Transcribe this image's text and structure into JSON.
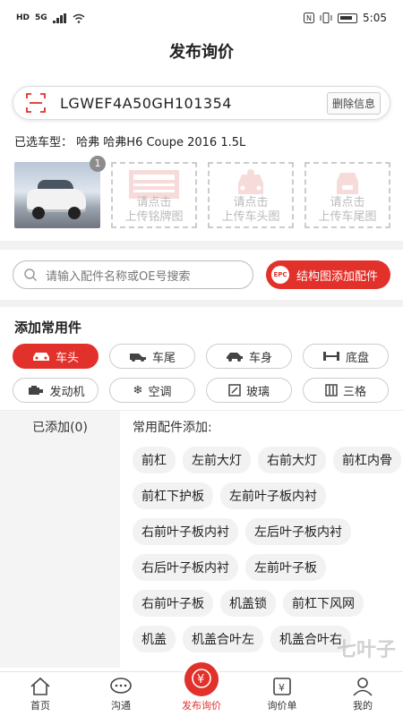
{
  "status": {
    "time": "5:05",
    "net": "HD",
    "sig": "5G"
  },
  "header": {
    "title": "发布询价"
  },
  "vin": {
    "value": "LGWEF4A50GH101354",
    "delete_label": "删除信息"
  },
  "model": {
    "label": "已选车型：",
    "value": "哈弗 哈弗H6 Coupe 2016 1.5L"
  },
  "photos": {
    "count": "1",
    "slots": [
      {
        "line1": "请点击",
        "line2": "上传铭牌图"
      },
      {
        "line1": "请点击",
        "line2": "上传车头图"
      },
      {
        "line1": "请点击",
        "line2": "上传车尾图"
      }
    ]
  },
  "search": {
    "placeholder": "请输入配件名称或OE号搜索",
    "epc_badge": "EPC",
    "epc_label": "结构图添加配件"
  },
  "common": {
    "title": "添加常用件",
    "categories": [
      {
        "label": "车头",
        "icon": "car-front-icon"
      },
      {
        "label": "车尾",
        "icon": "car-rear-icon"
      },
      {
        "label": "车身",
        "icon": "car-body-icon"
      },
      {
        "label": "底盘",
        "icon": "chassis-icon"
      },
      {
        "label": "发动机",
        "icon": "engine-icon"
      },
      {
        "label": "空调",
        "icon": "snowflake-icon"
      },
      {
        "label": "玻璃",
        "icon": "glass-icon"
      },
      {
        "label": "三格",
        "icon": "grid-icon"
      }
    ]
  },
  "added": {
    "label": "已添加(0)"
  },
  "parts": {
    "title": "常用配件添加:",
    "items": [
      "前杠",
      "左前大灯",
      "右前大灯",
      "前杠内骨",
      "前杠下护板",
      "左前叶子板内衬",
      "右前叶子板内衬",
      "左后叶子板内衬",
      "右后叶子板内衬",
      "左前叶子板",
      "右前叶子板",
      "机盖锁",
      "前杠下风网",
      "机盖",
      "机盖合叶左",
      "机盖合叶右"
    ]
  },
  "watermark": "七叶子",
  "tabs": [
    {
      "label": "首页",
      "icon": "home-icon"
    },
    {
      "label": "沟通",
      "icon": "chat-icon"
    },
    {
      "label": "发布询价",
      "icon": "yen-icon"
    },
    {
      "label": "询价单",
      "icon": "order-icon"
    },
    {
      "label": "我的",
      "icon": "user-icon"
    }
  ],
  "colors": {
    "accent": "#e2302a"
  }
}
